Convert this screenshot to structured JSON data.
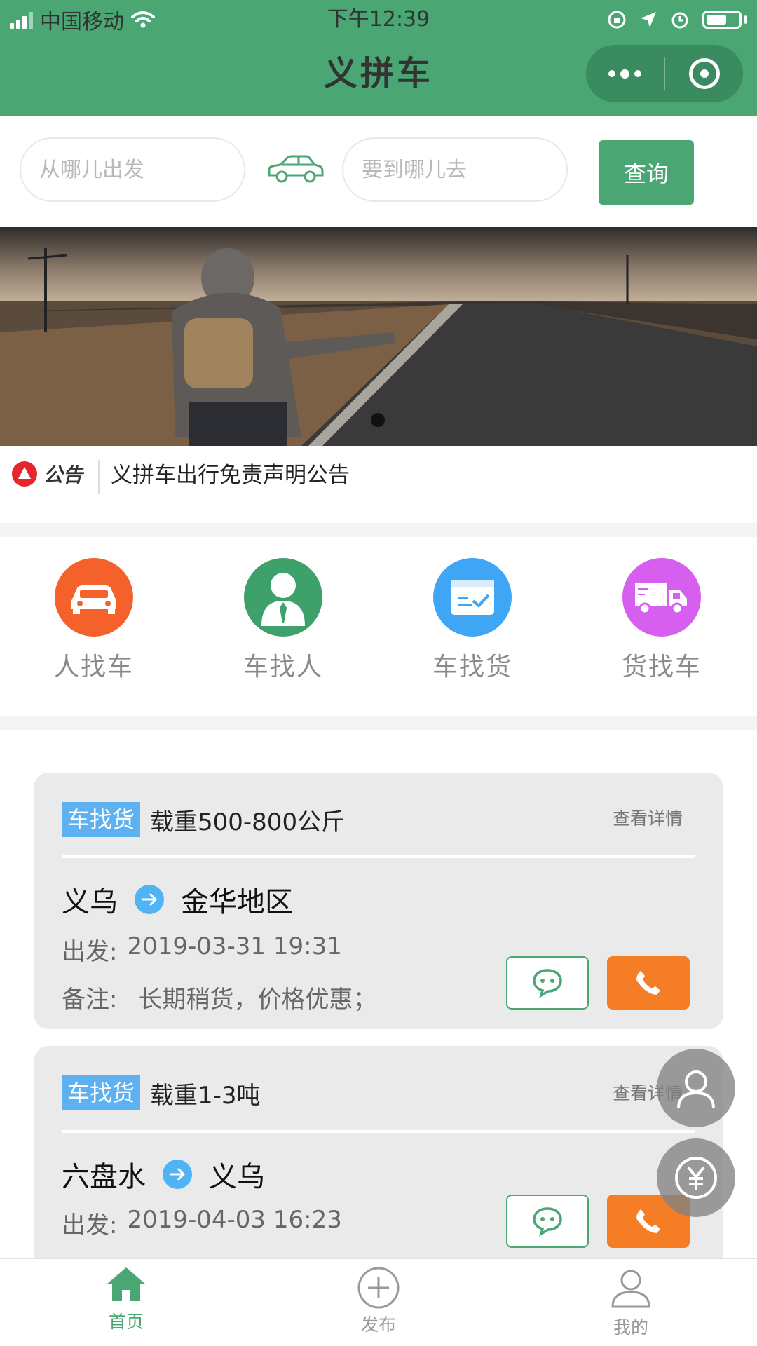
{
  "status_bar": {
    "carrier": "中国移动",
    "time": "下午12:39"
  },
  "header": {
    "title": "义拼车",
    "bg_color": "#4aa774"
  },
  "search": {
    "from_placeholder": "从哪儿出发",
    "to_placeholder": "要到哪儿去",
    "query_label": "查询"
  },
  "banner": {
    "icon": "hitchhiker-photo",
    "active_slide": 1,
    "slide_count": 1
  },
  "notice": {
    "badge": "公告",
    "text": "义拼车出行免责声明公告"
  },
  "categories": [
    {
      "label": "人找车",
      "color": "#f5612b",
      "icon": "car-icon"
    },
    {
      "label": "车找人",
      "color": "#3ea06a",
      "icon": "person-icon"
    },
    {
      "label": "车找货",
      "color": "#3fa5f5",
      "icon": "cargo-card-icon"
    },
    {
      "label": "货找车",
      "color": "#d65ff0",
      "icon": "truck-icon"
    }
  ],
  "listings": [
    {
      "tag": "车找货",
      "title": "载重500-800公斤",
      "detail_link": "查看详情",
      "from": "义乌",
      "to": "金华地区",
      "depart_label": "出发:",
      "depart_time": "2019-03-31 19:31",
      "note_label": "备注:",
      "note": "长期稍货，价格优惠；"
    },
    {
      "tag": "车找货",
      "title": "载重1-3吨",
      "detail_link": "查看详情",
      "from": "六盘水",
      "to": "义乌",
      "depart_label": "出发:",
      "depart_time": "2019-04-03 16:23"
    }
  ],
  "tabbar": [
    {
      "label": "首页",
      "icon": "home-icon",
      "active": true
    },
    {
      "label": "发布",
      "icon": "plus-circle-icon",
      "active": false
    },
    {
      "label": "我的",
      "icon": "user-icon",
      "active": false
    }
  ],
  "colors": {
    "accent": "#4aa774",
    "tag": "#5db1f0",
    "call": "#f47d26"
  }
}
